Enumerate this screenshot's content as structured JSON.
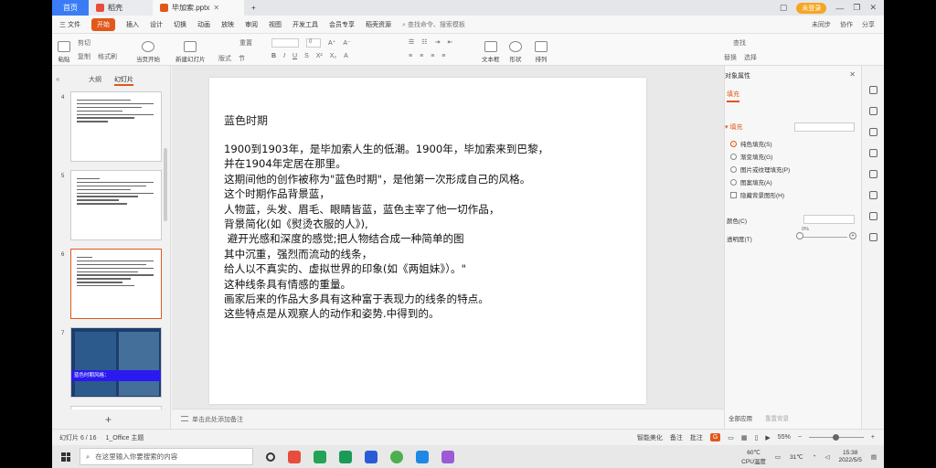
{
  "tabs": {
    "home": "首页",
    "sheet": "稻壳",
    "doc": "毕加索.pptx"
  },
  "login": "未登录",
  "menu": {
    "file": "三 文件",
    "items": [
      "开始",
      "插入",
      "设计",
      "切换",
      "动画",
      "放映",
      "审阅",
      "视图",
      "开发工具",
      "会员专享",
      "稻壳资源"
    ],
    "search": "查找命令、搜索模板",
    "right": [
      "未同步",
      "协作",
      "分享"
    ]
  },
  "toolbar": {
    "paste": "粘贴",
    "cut": "剪切",
    "copy": "复制",
    "format": "格式刷",
    "play": "当页开始",
    "newslide": "新建幻灯片",
    "layout": "版式",
    "section": "节",
    "reset": "重置",
    "textbox": "文本框",
    "shape": "形状",
    "arrange": "排列",
    "find": "查找",
    "replace": "替换",
    "select": "选择",
    "font_size": "0",
    "font_name": ""
  },
  "left": {
    "outline": "大纲",
    "slides": "幻灯片",
    "nums": [
      "4",
      "5",
      "6",
      "7"
    ],
    "thumb7_title": "蓝色时期风格："
  },
  "slide": {
    "title": "蓝色时期",
    "body": "1900到1903年，是毕加索人生的低潮。1900年，毕加索来到巴黎，\n并在1904年定居在那里。\n这期间他的创作被称为\"蓝色时期\"，是他第一次形成自己的风格。\n这个时期作品背景蓝，\n人物蓝，头发、眉毛、眼睛皆蓝，蓝色主宰了他一切作品，\n背景简化(如《熨烫衣服的人》),\n 避开光感和深度的感觉;把人物结合成一种简单的图\n其中沉重，强烈而流动的线条，\n给人以不真实的、虚拟世界的印象(如《两姐妹》）。\"\n这种线条具有情感的重量。\n画家后来的作品大多具有这种富于表现力的线条的特点。\n这些特点是从观察人的动作和姿势.中得到的。"
  },
  "notes": "单击此处添加备注",
  "right_panel": {
    "title": "对象属性",
    "fill_tab": "填充",
    "section": "填充",
    "options": [
      "纯色填充(S)",
      "渐变填充(G)",
      "图片或纹理填充(P)",
      "图案填充(A)",
      "隐藏背景图形(H)"
    ],
    "color_label": "颜色(C)",
    "transparency_label": "透明度(T)",
    "transparency": "0%",
    "apply_all": "全部应用",
    "reset_bg": "重置背景"
  },
  "status": {
    "slide": "幻灯片 6 / 16",
    "theme": "1_Office 主题",
    "beautify": "智能美化",
    "notes": "备注",
    "comment": "批注",
    "zoom": "55%"
  },
  "taskbar": {
    "search": "在这里输入你要搜索的内容",
    "cpu": "60℃\nCPU温度",
    "temp": "31℃",
    "time": "15:38",
    "date": "2022/5/5"
  }
}
